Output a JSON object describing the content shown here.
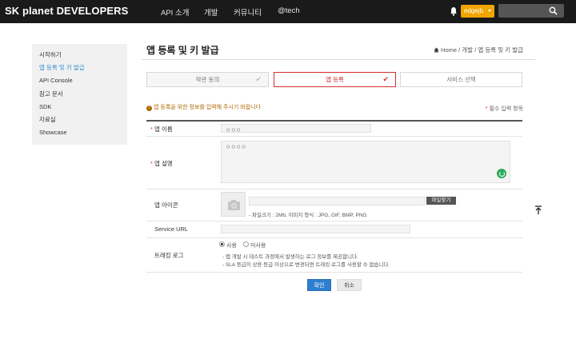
{
  "header": {
    "logo": "SK planet DEVELOPERS",
    "menu": [
      "API 소개",
      "개발",
      "커뮤니티",
      "@tech"
    ],
    "user": "edgejb",
    "search_placeholder": "",
    "accent": "#f0a500"
  },
  "sidebar": {
    "items": [
      {
        "label": "시작하기"
      },
      {
        "label": "앱 등록 및 키 발급"
      },
      {
        "label": "API Console"
      },
      {
        "label": "참고 문서"
      },
      {
        "label": "SDK"
      },
      {
        "label": "자료실"
      },
      {
        "label": "Showcase"
      }
    ],
    "active_index": 1
  },
  "page": {
    "title": "앱 등록 및 키 발급",
    "breadcrumb": "Home / 개발 / 앱 등록 및 키 발급"
  },
  "steps": [
    {
      "label": "약관 동의",
      "state": "done"
    },
    {
      "label": "앱 등록",
      "state": "active"
    },
    {
      "label": "서비스 선택",
      "state": "pending"
    }
  ],
  "notice": {
    "text": "앱 등록을 위한 정보를 입력해 주시기 바랍니다",
    "required_mark": "*",
    "required_text": "필수 입력 항목"
  },
  "form": {
    "app_name": {
      "label": "앱 이름",
      "value": "ㅇㅇㅇ"
    },
    "app_desc": {
      "label": "앱 설명",
      "value": "ㅇㅇㅇㅇ"
    },
    "app_icon": {
      "label": "앱 아이콘",
      "file_button": "파일찾기",
      "hint": "- 파일크기 : 2Mb, 이미지 형식 : JPG, GIF, BMP, PNG"
    },
    "service_url": {
      "label": "Service URL",
      "value": ""
    },
    "tracking_log": {
      "label": "트래킹 로그",
      "options": [
        "사용",
        "미사용"
      ],
      "selected": "사용",
      "help": [
        "- 앱 개발 시 테스트 과정에서 발생하는 로그 정보를 제공합니다.",
        "- SLA 등급이 상용 등급 이상으로 변경되면 트래킹 로그를 사용할 수 없습니다."
      ]
    }
  },
  "buttons": {
    "confirm": "확인",
    "cancel": "취소"
  }
}
